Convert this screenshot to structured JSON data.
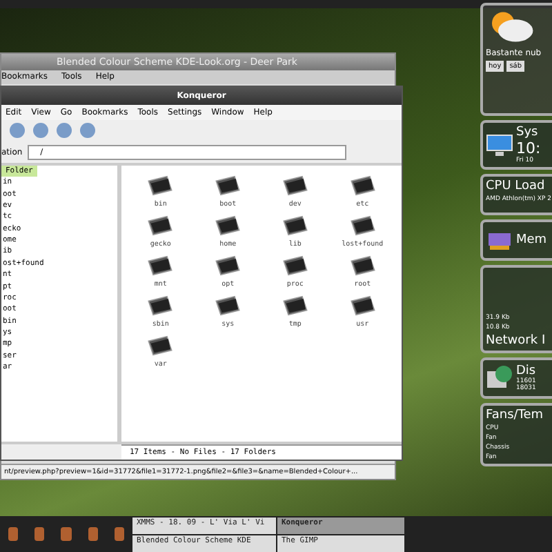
{
  "back_window": {
    "title": "Blended Colour Scheme KDE-Look.org - Deer Park",
    "menu": [
      "Bookmarks",
      "Tools",
      "Help"
    ],
    "status": "nt/preview.php?preview=1&id=31772&file1=31772-1.png&file2=&file3=&name=Blended+Colour+..."
  },
  "konqueror": {
    "title": "Konqueror",
    "menu": [
      "Edit",
      "View",
      "Go",
      "Bookmarks",
      "Tools",
      "Settings",
      "Window",
      "Help"
    ],
    "location_label": "ation",
    "location": "/",
    "tree": {
      "header": "Folder",
      "items": [
        "in",
        "oot",
        "ev",
        "tc",
        "ecko",
        "ome",
        "ib",
        "ost+found",
        "nt",
        "pt",
        "roc",
        "oot",
        "bin",
        "ys",
        "mp",
        "ser",
        "ar"
      ]
    },
    "folders": [
      "bin",
      "boot",
      "dev",
      "etc",
      "gecko",
      "home",
      "lib",
      "lost+found",
      "mnt",
      "opt",
      "proc",
      "root",
      "sbin",
      "sys",
      "tmp",
      "usr",
      "var"
    ],
    "status": "17 Items - No Files - 17 Folders"
  },
  "widgets": {
    "weather": {
      "text": "Bastante nub",
      "days": [
        "hoy",
        "sáb"
      ]
    },
    "system": {
      "title": "Sys",
      "time": "10:",
      "date": "Fri 10"
    },
    "cpu": {
      "title": "CPU Load",
      "model": "AMD Athlon(tm) XP 2"
    },
    "memory": {
      "title": "Mem"
    },
    "network": {
      "readings": [
        "31.9 Kb",
        "10.8 Kb"
      ],
      "title": "Network I"
    },
    "disk": {
      "title": "Dis",
      "values": [
        "11601",
        "18031"
      ]
    },
    "fans": {
      "title": "Fans/Tem",
      "labels": [
        "CPU",
        "Fan",
        "Chassis",
        "Fan"
      ]
    }
  },
  "taskbar": {
    "tasks": [
      {
        "label": "XMMS - 18. 09 - L' Via L' Vi",
        "selected": false
      },
      {
        "label": "Konqueror",
        "selected": true
      },
      {
        "label": "Blended Colour Scheme KDE",
        "selected": false
      },
      {
        "label": "The GIMP",
        "selected": false
      }
    ]
  }
}
